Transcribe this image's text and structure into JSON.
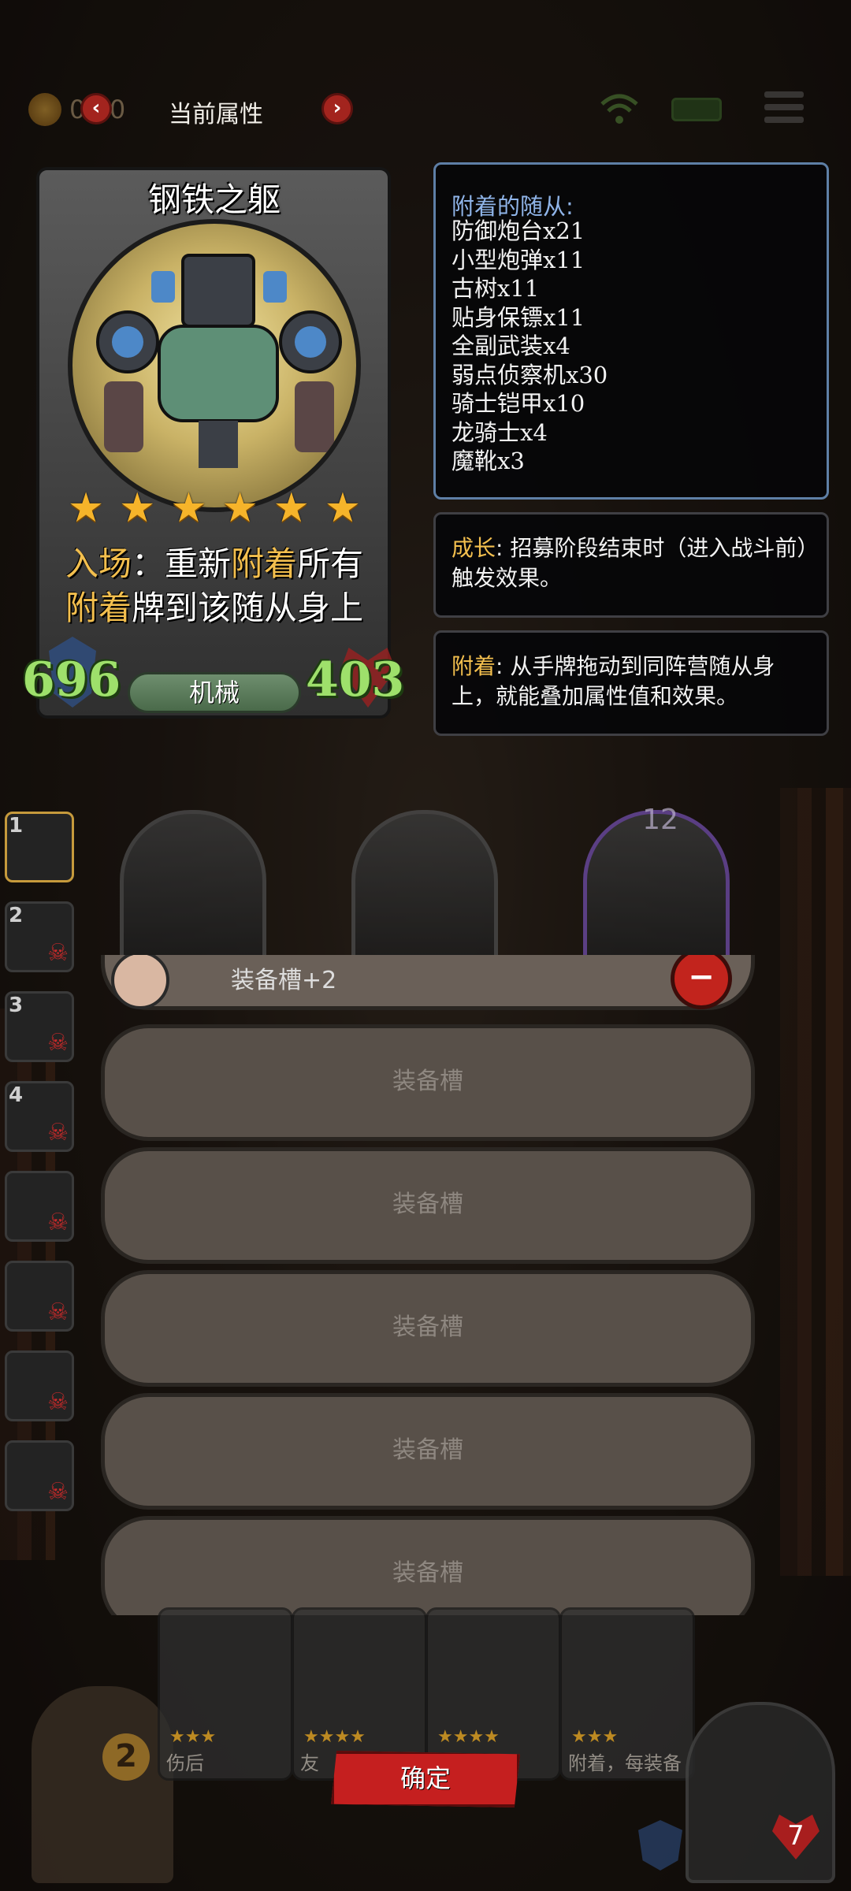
{
  "topbar": {
    "title": "当前属性",
    "coin_value": "0 20",
    "prev_glyph": "‹",
    "next_glyph": "›"
  },
  "card": {
    "name": "钢铁之躯",
    "stars": 6,
    "description_parts": [
      {
        "text": "入场",
        "highlight": true
      },
      {
        "text": "：重新",
        "highlight": false
      },
      {
        "text": "附着",
        "highlight": true
      },
      {
        "text": "所有",
        "highlight": false
      },
      {
        "text": "附着",
        "highlight": true
      },
      {
        "text": "牌到该随从身上",
        "highlight": false
      }
    ],
    "attack": "696",
    "health": "403",
    "tribe": "机械"
  },
  "attached": {
    "title": "附着的随从:",
    "items": [
      "防御炮台x21",
      "小型炮弹x11",
      "古树x11",
      "贴身保镖x11",
      "全副武装x4",
      "弱点侦察机x30",
      "骑士铠甲x10",
      "龙骑士x4",
      "魔靴x3"
    ]
  },
  "growth": {
    "keyword": "成长",
    "text": ": 招募阶段结束时（进入战斗前）触发效果。"
  },
  "attach_info": {
    "keyword": "附着",
    "text": ": 从手牌拖动到同阵营随从身上，就能叠加属性值和效果。"
  },
  "board": {
    "level": "12"
  },
  "sidebar": {
    "items": [
      {
        "num": "1",
        "active": true,
        "skull": false
      },
      {
        "num": "2",
        "active": false,
        "skull": true
      },
      {
        "num": "3",
        "active": false,
        "skull": true
      },
      {
        "num": "4",
        "active": false,
        "skull": true
      },
      {
        "num": "",
        "active": false,
        "skull": true
      },
      {
        "num": "",
        "active": false,
        "skull": true
      },
      {
        "num": "",
        "active": false,
        "skull": true
      },
      {
        "num": "",
        "active": false,
        "skull": true
      }
    ]
  },
  "equipment": {
    "top_item_label": "装备槽+2",
    "remove_glyph": "−",
    "slots": [
      "装备槽",
      "装备槽",
      "装备槽",
      "装备槽",
      "装备槽"
    ]
  },
  "hand": {
    "cards": [
      {
        "text": "伤后"
      },
      {
        "text": "友"
      },
      {
        "text": ""
      },
      {
        "text": "附着，每装备"
      }
    ]
  },
  "footer": {
    "confirm": "确定",
    "gold": "2",
    "hero_hp": "7"
  },
  "colors": {
    "keyword": "#f3bf4e",
    "stat": "#9ee06b",
    "confirm": "#c51f1f",
    "attach_title": "#8fb4e8"
  }
}
